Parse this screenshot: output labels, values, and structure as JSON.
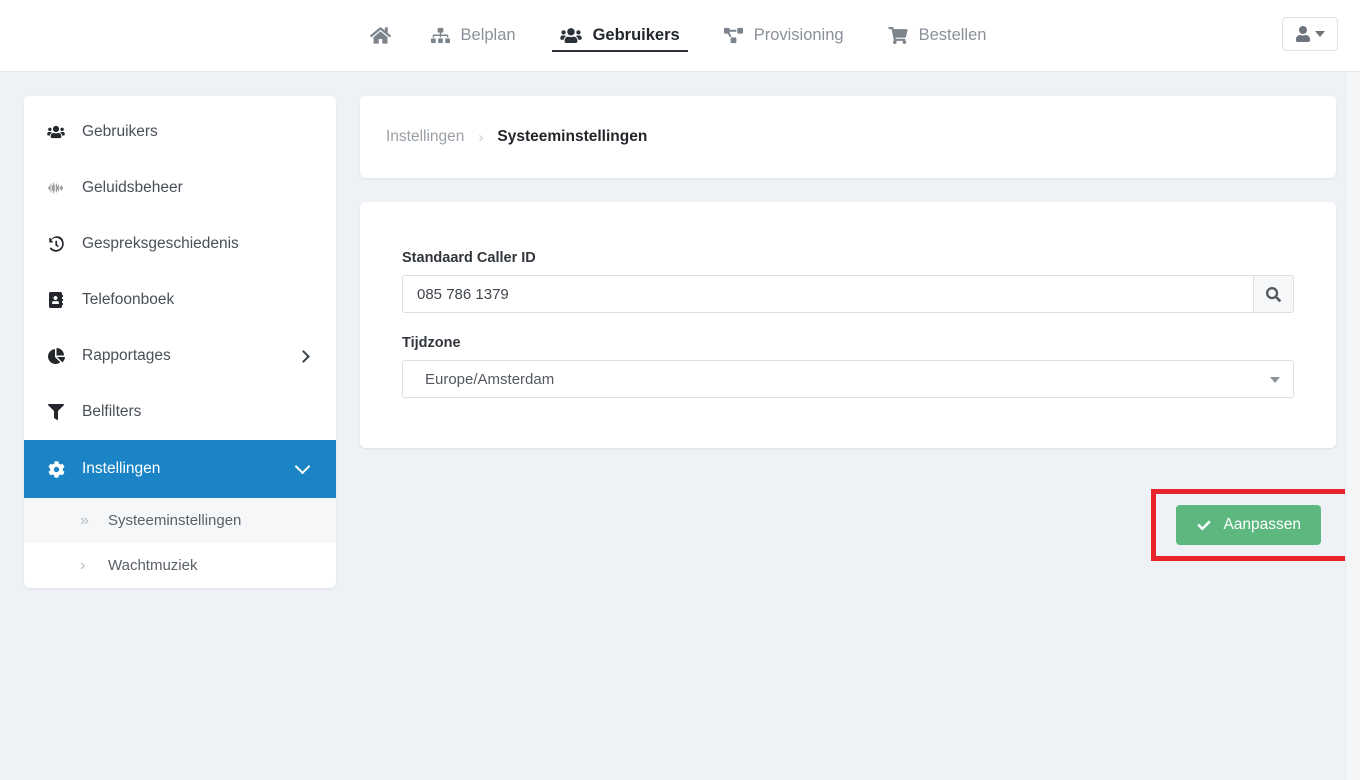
{
  "topnav": {
    "items": [
      {
        "label": "",
        "icon": "home-icon",
        "name": "nav-home",
        "active": false
      },
      {
        "label": "Belplan",
        "icon": "sitemap-icon",
        "name": "nav-belplan",
        "active": false
      },
      {
        "label": "Gebruikers",
        "icon": "users-icon",
        "name": "nav-gebruikers",
        "active": true
      },
      {
        "label": "Provisioning",
        "icon": "project-diagram-icon",
        "name": "nav-provisioning",
        "active": false
      },
      {
        "label": "Bestellen",
        "icon": "shopping-cart-icon",
        "name": "nav-bestellen",
        "active": false
      }
    ],
    "user_menu_icon": "user-icon"
  },
  "sidebar": {
    "items": [
      {
        "label": "Gebruikers",
        "icon": "users-icon"
      },
      {
        "label": "Geluidsbeheer",
        "icon": "waveform-icon"
      },
      {
        "label": "Gespreksgeschiedenis",
        "icon": "history-icon"
      },
      {
        "label": "Telefoonboek",
        "icon": "address-book-icon"
      },
      {
        "label": "Rapportages",
        "icon": "pie-chart-icon",
        "chevron": "right"
      },
      {
        "label": "Belfilters",
        "icon": "filter-icon"
      },
      {
        "label": "Instellingen",
        "icon": "gear-icon",
        "active": true,
        "chevron": "down"
      }
    ],
    "subitems": [
      {
        "label": "Systeeminstellingen",
        "chevron": "»",
        "current": true
      },
      {
        "label": "Wachtmuziek",
        "chevron": "›",
        "current": false
      }
    ]
  },
  "breadcrumb": {
    "parent": "Instellingen",
    "separator": "›",
    "current": "Systeeminstellingen"
  },
  "form": {
    "caller_id": {
      "label": "Standaard Caller ID",
      "value": "085 786 1379",
      "placeholder": "",
      "addon_icon": "search-icon"
    },
    "timezone": {
      "label": "Tijdzone",
      "value": "Europe/Amsterdam",
      "caret_icon": "chevron-down-icon"
    }
  },
  "actions": {
    "save_label": "Aanpassen",
    "save_icon": "check-icon"
  },
  "colors": {
    "page_background": "#eef1f5",
    "sidebar_active": "#1b84c6",
    "save_button": "#5cb87f",
    "highlight_border": "#e8242a",
    "card_background": "#ffffff"
  }
}
